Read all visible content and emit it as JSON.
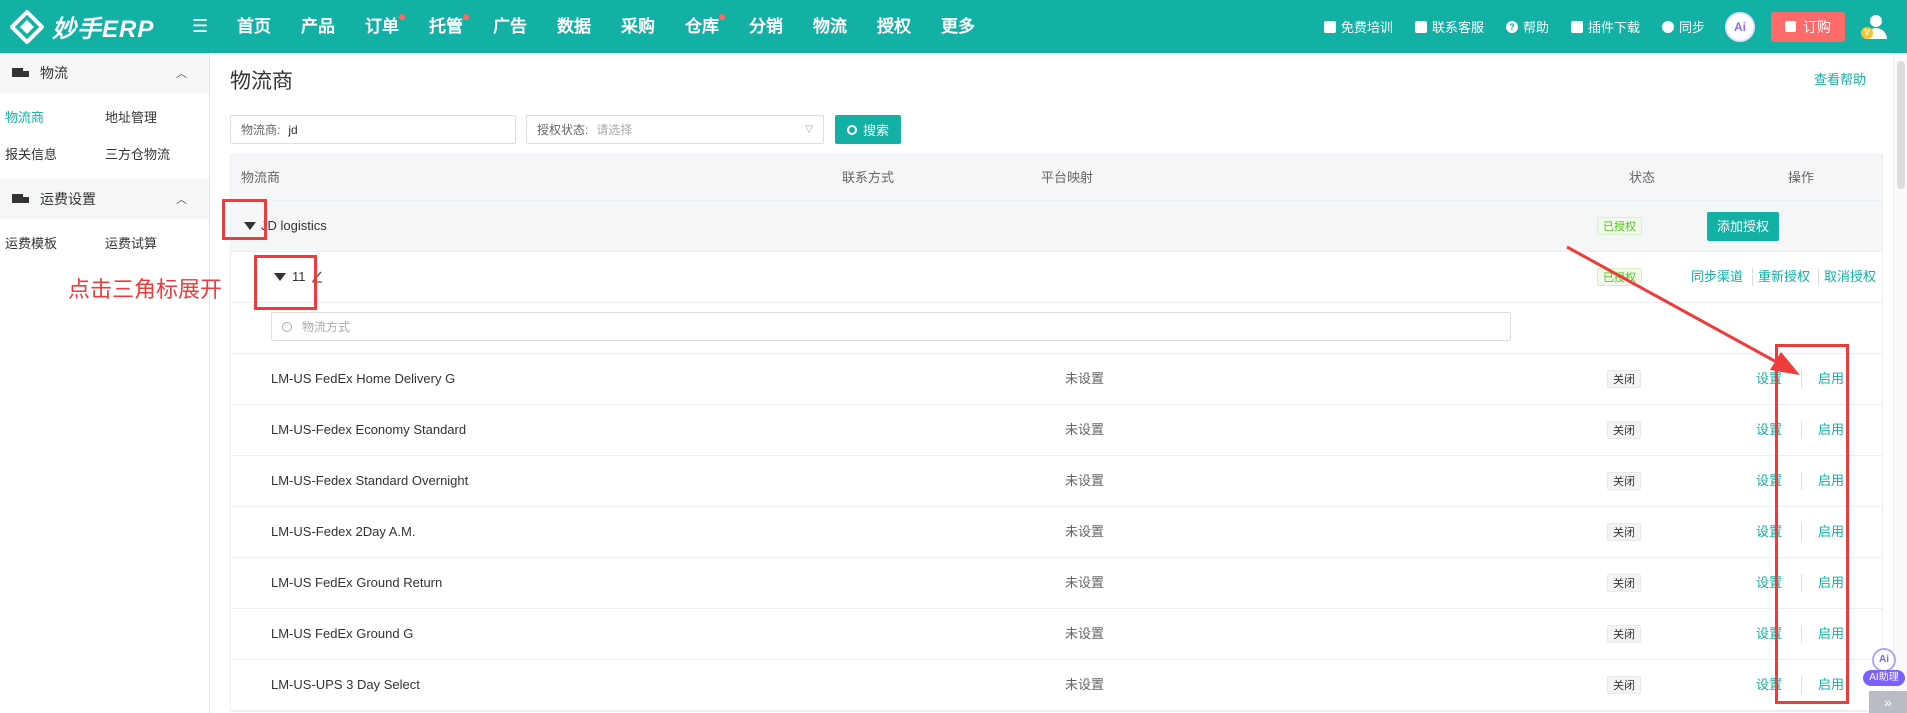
{
  "app": {
    "logo_text": "妙手ERP"
  },
  "nav": {
    "items": [
      {
        "label": "首页",
        "dot": false
      },
      {
        "label": "产品",
        "dot": false
      },
      {
        "label": "订单",
        "dot": true
      },
      {
        "label": "托管",
        "dot": true
      },
      {
        "label": "广告",
        "dot": false
      },
      {
        "label": "数据",
        "dot": false
      },
      {
        "label": "采购",
        "dot": false
      },
      {
        "label": "仓库",
        "dot": true
      },
      {
        "label": "分销",
        "dot": false
      },
      {
        "label": "物流",
        "dot": false
      },
      {
        "label": "授权",
        "dot": false
      },
      {
        "label": "更多",
        "dot": false
      }
    ],
    "right": {
      "training": "免费培训",
      "support": "联系客服",
      "help": "帮助",
      "plugin": "插件下载",
      "sync": "同步",
      "ai": "Ai",
      "order": "订购",
      "vip": "V"
    }
  },
  "sidebar": {
    "groups": [
      {
        "title": "物流",
        "items": [
          "物流商",
          "地址管理",
          "报关信息",
          "三方仓物流"
        ]
      },
      {
        "title": "运费设置",
        "items": [
          "运费模板",
          "运费试算"
        ]
      }
    ]
  },
  "main": {
    "title": "物流商",
    "help": "查看帮助",
    "filter": {
      "provider_label": "物流商:",
      "provider_value": "jd",
      "status_label": "授权状态:",
      "status_placeholder": "请选择",
      "search_label": "搜索"
    },
    "table": {
      "headers": [
        "物流商",
        "联系方式",
        "平台映射",
        "状态",
        "操作"
      ],
      "parent": {
        "name": "JD logistics",
        "status": "已授权",
        "action": "添加授权"
      },
      "account": {
        "name": "11",
        "status": "已授权",
        "actions": [
          "同步渠道",
          "重新授权",
          "取消授权"
        ],
        "search_placeholder": "物流方式"
      },
      "rows": [
        {
          "name": "LM-US FedEx Home Delivery G",
          "mapping": "未设置",
          "status": "关闭",
          "settings": "设置",
          "enable": "启用"
        },
        {
          "name": "LM-US-Fedex Economy Standard",
          "mapping": "未设置",
          "status": "关闭",
          "settings": "设置",
          "enable": "启用"
        },
        {
          "name": "LM-US-Fedex Standard Overnight",
          "mapping": "未设置",
          "status": "关闭",
          "settings": "设置",
          "enable": "启用"
        },
        {
          "name": "LM-US-Fedex 2Day A.M.",
          "mapping": "未设置",
          "status": "关闭",
          "settings": "设置",
          "enable": "启用"
        },
        {
          "name": "LM-US FedEx Ground Return",
          "mapping": "未设置",
          "status": "关闭",
          "settings": "设置",
          "enable": "启用"
        },
        {
          "name": "LM-US FedEx Ground G",
          "mapping": "未设置",
          "status": "关闭",
          "settings": "设置",
          "enable": "启用"
        },
        {
          "name": "LM-US-UPS 3 Day Select",
          "mapping": "未设置",
          "status": "关闭",
          "settings": "设置",
          "enable": "启用"
        }
      ]
    }
  },
  "annotation": {
    "text": "点击三角标展开"
  },
  "ai_helper": {
    "icon": "Ai",
    "label": "AI助理"
  },
  "corner": {
    "label": "»"
  },
  "colors": {
    "brand": "#13b0a5",
    "annotation": "#ee3b3b",
    "order": "#ff6a6a"
  }
}
